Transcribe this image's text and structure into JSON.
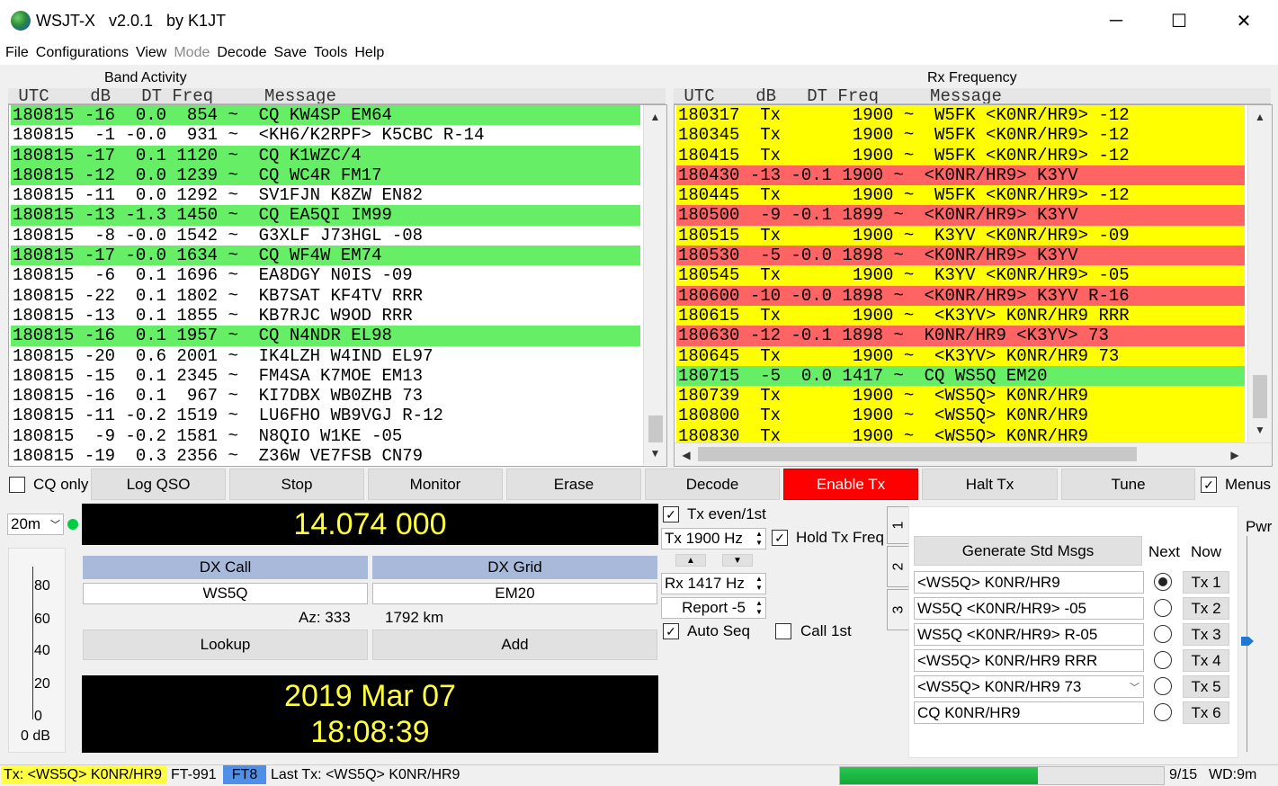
{
  "window": {
    "title": "WSJT-X   v2.0.1   by K1JT",
    "minimize": "─",
    "maximize": "☐",
    "close": "✕"
  },
  "menu": [
    "File",
    "Configurations",
    "View",
    "Mode",
    "Decode",
    "Save",
    "Tools",
    "Help"
  ],
  "band_activity": {
    "label": "Band Activity",
    "header": " UTC    dB   DT Freq     Message",
    "rows": [
      {
        "text": "180815 -16  0.0  854 ~  CQ KW4SP EM64",
        "hl": "green"
      },
      {
        "text": "180815  -1 -0.0  931 ~  <KH6/K2RPF> K5CBC R-14",
        "hl": ""
      },
      {
        "text": "180815 -17  0.1 1120 ~  CQ K1WZC/4",
        "hl": "green"
      },
      {
        "text": "180815 -12  0.0 1239 ~  CQ WC4R FM17",
        "hl": "green"
      },
      {
        "text": "180815 -11  0.0 1292 ~  SV1FJN K8ZW EN82",
        "hl": ""
      },
      {
        "text": "180815 -13 -1.3 1450 ~  CQ EA5QI IM99",
        "hl": "green"
      },
      {
        "text": "180815  -8 -0.0 1542 ~  G3XLF J73HGL -08",
        "hl": ""
      },
      {
        "text": "180815 -17 -0.0 1634 ~  CQ WF4W EM74",
        "hl": "green"
      },
      {
        "text": "180815  -6  0.1 1696 ~  EA8DGY N0IS -09",
        "hl": ""
      },
      {
        "text": "180815 -22  0.1 1802 ~  KB7SAT KF4TV RRR",
        "hl": ""
      },
      {
        "text": "180815 -13  0.1 1855 ~  KB7RJC W9OD RRR",
        "hl": ""
      },
      {
        "text": "180815 -16  0.1 1957 ~  CQ N4NDR EL98",
        "hl": "green"
      },
      {
        "text": "180815 -20  0.6 2001 ~  IK4LZH W4IND EL97",
        "hl": ""
      },
      {
        "text": "180815 -15  0.1 2345 ~  FM4SA K7MOE EM13",
        "hl": ""
      },
      {
        "text": "180815 -16  0.1  967 ~  KI7DBX WB0ZHB 73",
        "hl": ""
      },
      {
        "text": "180815 -11 -0.2 1519 ~  LU6FHO WB9VGJ R-12",
        "hl": ""
      },
      {
        "text": "180815  -9 -0.2 1581 ~  N8QIO W1KE -05",
        "hl": ""
      },
      {
        "text": "180815 -19  0.3 2356 ~  Z36W VE7FSB CN79",
        "hl": ""
      }
    ]
  },
  "rx_frequency": {
    "label": "Rx Frequency",
    "header": " UTC    dB   DT Freq     Message",
    "rows": [
      {
        "text": "180317  Tx       1900 ~  W5FK <K0NR/HR9> -12",
        "hl": "yellow"
      },
      {
        "text": "180345  Tx       1900 ~  W5FK <K0NR/HR9> -12",
        "hl": "yellow"
      },
      {
        "text": "180415  Tx       1900 ~  W5FK <K0NR/HR9> -12",
        "hl": "yellow"
      },
      {
        "text": "180430 -13 -0.1 1900 ~  <K0NR/HR9> K3YV",
        "hl": "red"
      },
      {
        "text": "180445  Tx       1900 ~  W5FK <K0NR/HR9> -12",
        "hl": "yellow"
      },
      {
        "text": "180500  -9 -0.1 1899 ~  <K0NR/HR9> K3YV",
        "hl": "red"
      },
      {
        "text": "180515  Tx       1900 ~  K3YV <K0NR/HR9> -09",
        "hl": "yellow"
      },
      {
        "text": "180530  -5 -0.0 1898 ~  <K0NR/HR9> K3YV",
        "hl": "red"
      },
      {
        "text": "180545  Tx       1900 ~  K3YV <K0NR/HR9> -05",
        "hl": "yellow"
      },
      {
        "text": "180600 -10 -0.0 1898 ~  <K0NR/HR9> K3YV R-16",
        "hl": "red"
      },
      {
        "text": "180615  Tx       1900 ~  <K3YV> K0NR/HR9 RRR",
        "hl": "yellow"
      },
      {
        "text": "180630 -12 -0.1 1898 ~  K0NR/HR9 <K3YV> 73",
        "hl": "red"
      },
      {
        "text": "180645  Tx       1900 ~  <K3YV> K0NR/HR9 73",
        "hl": "yellow"
      },
      {
        "text": "180715  -5  0.0 1417 ~  CQ WS5Q EM20",
        "hl": "green"
      },
      {
        "text": "180739  Tx       1900 ~  <WS5Q> K0NR/HR9",
        "hl": "yellow"
      },
      {
        "text": "180800  Tx       1900 ~  <WS5Q> K0NR/HR9",
        "hl": "yellow"
      },
      {
        "text": "180830  Tx       1900 ~  <WS5Q> K0NR/HR9",
        "hl": "yellow"
      }
    ]
  },
  "controls": {
    "cq_only": "CQ only",
    "log_qso": "Log QSO",
    "stop": "Stop",
    "monitor": "Monitor",
    "erase": "Erase",
    "decode": "Decode",
    "enable_tx": "Enable Tx",
    "halt_tx": "Halt Tx",
    "tune": "Tune",
    "menus": "Menus"
  },
  "band": "20m",
  "frequency": "14.074 000",
  "dx": {
    "call_label": "DX Call",
    "grid_label": "DX Grid",
    "call": "WS5Q",
    "grid": "EM20",
    "az": "Az: 333",
    "distance": "1792 km",
    "lookup": "Lookup",
    "add": "Add"
  },
  "clock": {
    "date": "2019 Mar 07",
    "time": "18:08:39"
  },
  "meter": {
    "ticks": [
      "80",
      "60",
      "40",
      "20",
      "0"
    ],
    "unit": "0 dB"
  },
  "tx_opts": {
    "tx_even": "Tx even/1st",
    "tx_freq": "Tx  1900  Hz",
    "hold_tx": "Hold Tx Freq",
    "rx_freq": "Rx  1417  Hz",
    "report": "Report -5",
    "auto_seq": "Auto Seq",
    "call_1st": "Call 1st"
  },
  "tabs": [
    "1",
    "2",
    "3"
  ],
  "msgs": {
    "generate": "Generate Std Msgs",
    "next": "Next",
    "now": "Now",
    "items": [
      {
        "text": "<WS5Q> K0NR/HR9",
        "btn": "Tx 1"
      },
      {
        "text": "WS5Q <K0NR/HR9> -05",
        "btn": "Tx 2"
      },
      {
        "text": "WS5Q <K0NR/HR9> R-05",
        "btn": "Tx 3"
      },
      {
        "text": "<WS5Q> K0NR/HR9 RRR",
        "btn": "Tx 4"
      },
      {
        "text": "<WS5Q> K0NR/HR9 73",
        "btn": "Tx 5"
      },
      {
        "text": "CQ K0NR/HR9",
        "btn": "Tx 6"
      }
    ],
    "selected_next": 0
  },
  "pwr_label": "Pwr",
  "status": {
    "tx": "Tx: <WS5Q> K0NR/HR9",
    "rig": "FT-991",
    "mode": "FT8",
    "last_tx": "Last Tx: <WS5Q> K0NR/HR9",
    "progress": 0.61,
    "counter": "9/15",
    "wd": "WD:9m"
  },
  "colors": {
    "green": "#66ee66",
    "yellow": "#ffff00",
    "red": "#ff6464",
    "enable_tx": "#ff0000",
    "mode_badge": "#4f8fe8"
  }
}
